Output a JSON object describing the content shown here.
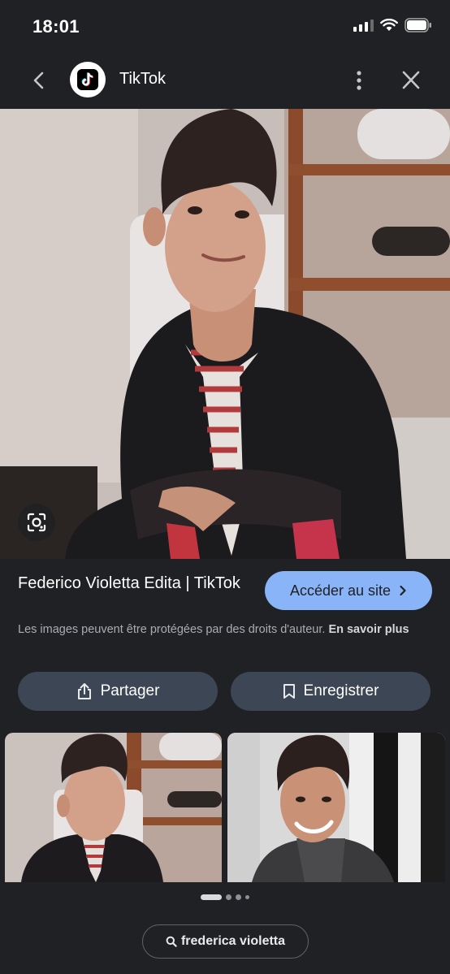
{
  "status_bar": {
    "time": "18:01"
  },
  "app_bar": {
    "site_name": "TikTok",
    "back_icon": "chevron-left-icon",
    "more_icon": "more-vertical-icon",
    "close_icon": "close-icon",
    "logo_icon": "tiktok-logo"
  },
  "result": {
    "title": "Federico Violetta Edita | TikTok",
    "visit_label": "Accéder au site",
    "copyright_text": "Les images peuvent être protégées par des droits d'auteur.",
    "learn_more": "En savoir plus"
  },
  "actions": {
    "share_label": "Partager",
    "save_label": "Enregistrer"
  },
  "pager": {
    "page_count": 4,
    "active_index": 0
  },
  "search_chip": {
    "label": "frederica violetta"
  },
  "colors": {
    "background": "#202124",
    "accent": "#8ab4f8",
    "pill": "#3c4654"
  }
}
